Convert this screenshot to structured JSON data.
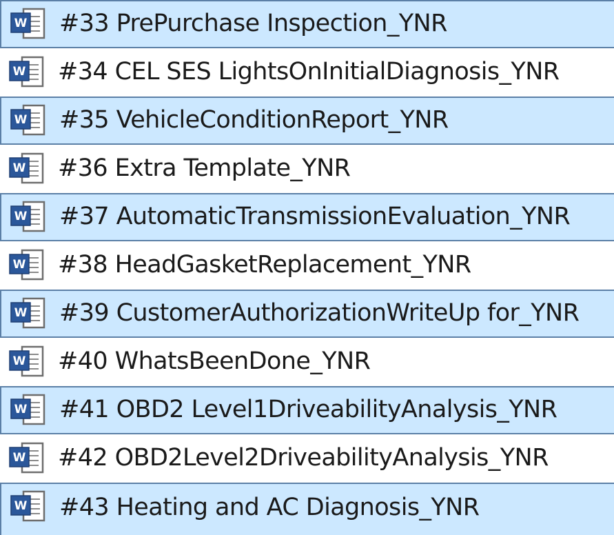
{
  "file_list": {
    "items": [
      {
        "name": "#33 PrePurchase Inspection_YNR",
        "icon": "word-document-icon",
        "selected": true
      },
      {
        "name": "#34 CEL SES LightsOnInitialDiagnosis_YNR",
        "icon": "word-document-icon",
        "selected": false
      },
      {
        "name": "#35 VehicleConditionReport_YNR",
        "icon": "word-document-icon",
        "selected": true
      },
      {
        "name": "#36 Extra Template_YNR",
        "icon": "word-document-icon",
        "selected": false
      },
      {
        "name": "#37 AutomaticTransmissionEvaluation_YNR",
        "icon": "word-document-icon",
        "selected": true
      },
      {
        "name": "#38 HeadGasketReplacement_YNR",
        "icon": "word-document-icon",
        "selected": false
      },
      {
        "name": "#39 CustomerAuthorizationWriteUp for_YNR",
        "icon": "word-document-icon",
        "selected": true
      },
      {
        "name": "#40 WhatsBeenDone_YNR",
        "icon": "word-document-icon",
        "selected": false
      },
      {
        "name": "#41 OBD2 Level1DriveabilityAnalysis_YNR",
        "icon": "word-document-icon",
        "selected": true
      },
      {
        "name": "#42 OBD2Level2DriveabilityAnalysis_YNR",
        "icon": "word-document-icon",
        "selected": false
      },
      {
        "name": "#43 Heating and AC Diagnosis_YNR",
        "icon": "word-document-icon",
        "selected": true
      }
    ]
  },
  "colors": {
    "selection_background": "#cce8ff",
    "selection_border": "#5b7fa6",
    "word_icon_blue": "#2b579a"
  }
}
